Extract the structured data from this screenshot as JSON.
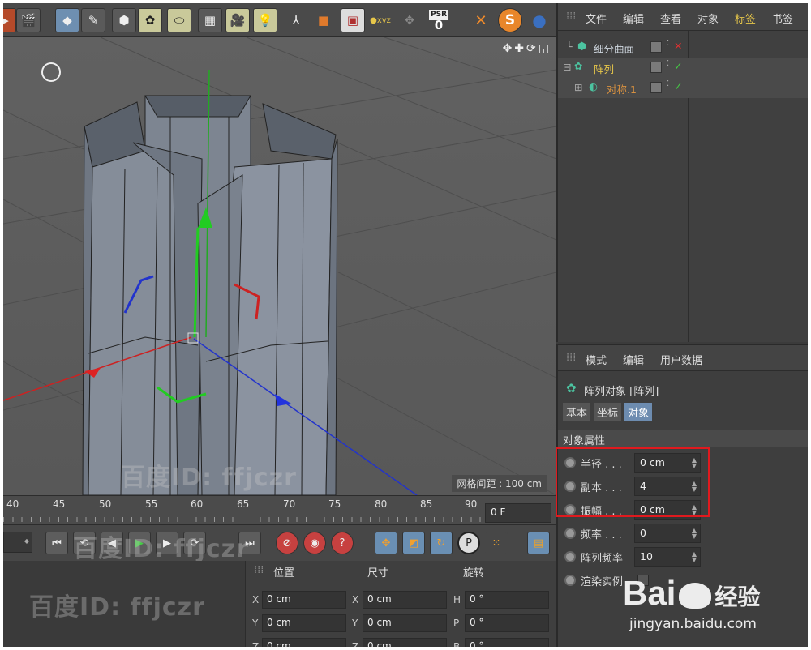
{
  "toolbar": {
    "icons": [
      "render-icon",
      "cube-icon",
      "pen-icon",
      "subdivision-icon",
      "array-icon",
      "deformer-icon",
      "floor-icon",
      "camera-icon",
      "light-icon",
      "axis-icon",
      "box-icon",
      "texture-icon",
      "xyz-icon",
      "lock-icon",
      "psr-icon",
      "spread-icon",
      "s-icon",
      "python-icon"
    ],
    "psr_label": "PSR",
    "psr_value": "0"
  },
  "viewport": {
    "grid_label": "网格间距 : 100 cm",
    "watermark": "百度ID: ffjczr"
  },
  "timeline": {
    "ticks": [
      "40",
      "45",
      "50",
      "55",
      "60",
      "65",
      "70",
      "75",
      "80",
      "85",
      "90"
    ],
    "current_frame": "0 F"
  },
  "coords": {
    "headers": [
      "位置",
      "尺寸",
      "旋转"
    ],
    "rows": [
      {
        "a": "X",
        "pos": "0 cm",
        "b": "X",
        "size": "0 cm",
        "c": "H",
        "rot": "0 °"
      },
      {
        "a": "Y",
        "pos": "0 cm",
        "b": "Y",
        "size": "0 cm",
        "c": "P",
        "rot": "0 °"
      },
      {
        "a": "Z",
        "pos": "0 cm",
        "b": "Z",
        "size": "0 cm",
        "c": "B",
        "rot": "0 °"
      }
    ]
  },
  "object_manager": {
    "menu": [
      "文件",
      "编辑",
      "查看",
      "对象",
      "标签",
      "书签"
    ],
    "objects": [
      {
        "name": "细分曲面",
        "color": "#cfd7df"
      },
      {
        "name": "阵列",
        "color": "#e6c64a"
      },
      {
        "name": "对称.1",
        "color": "#d69040"
      }
    ]
  },
  "attribute_manager": {
    "menu": [
      "模式",
      "编辑",
      "用户数据"
    ],
    "title": "阵列对象 [阵列]",
    "tabs": [
      "基本",
      "坐标",
      "对象"
    ],
    "section": "对象属性",
    "props": [
      {
        "label": "半径 . . .",
        "value": "0 cm"
      },
      {
        "label": "副本 . . .",
        "value": "4"
      },
      {
        "label": "振幅 . . .",
        "value": "0 cm"
      },
      {
        "label": "频率 . . .",
        "value": "0"
      },
      {
        "label": "阵列频率",
        "value": "10"
      },
      {
        "label": "渲染实例",
        "value": ""
      }
    ]
  },
  "baidu": {
    "brand": "Bai",
    "brand2": "经验",
    "url": "jingyan.baidu.com"
  }
}
